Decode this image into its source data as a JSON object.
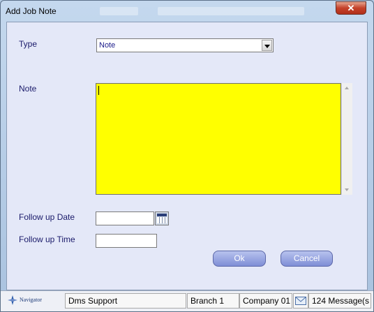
{
  "window": {
    "title": "Add Job Note",
    "close_label": "✕"
  },
  "form": {
    "type_label": "Type",
    "type_value": "Note",
    "note_label": "Note",
    "note_value": "",
    "follow_up_date_label": "Follow up Date",
    "follow_up_date_value": "",
    "follow_up_time_label": "Follow up Time",
    "follow_up_time_value": "",
    "note_bg_color": "#ffff00"
  },
  "buttons": {
    "ok_label": "Ok",
    "cancel_label": "Cancel"
  },
  "statusbar": {
    "logo_text": "Navigator",
    "user": "Dms Support",
    "branch": "Branch 1",
    "company": "Company 01",
    "messages": "124 Message(s"
  }
}
